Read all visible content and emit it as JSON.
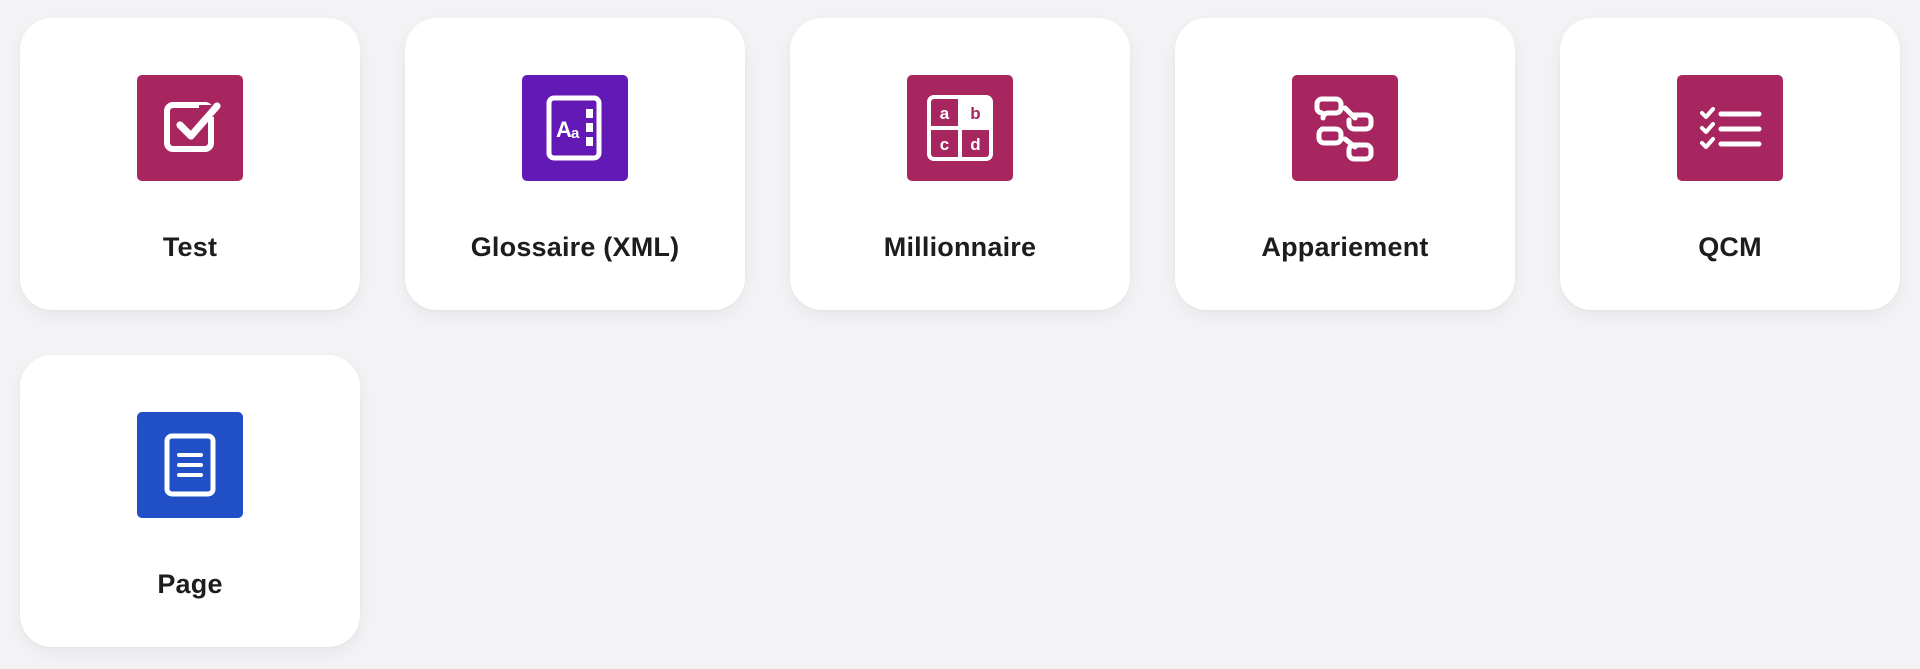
{
  "tiles": [
    {
      "label": "Test",
      "icon": "checkbox-icon",
      "color": "#a8265f"
    },
    {
      "label": "Glossaire (XML)",
      "icon": "glossary-book-icon",
      "color": "#6219b5"
    },
    {
      "label": "Millionnaire",
      "icon": "abcd-grid-icon",
      "color": "#a8265f"
    },
    {
      "label": "Appariement",
      "icon": "matching-connectors-icon",
      "color": "#a8265f"
    },
    {
      "label": "QCM",
      "icon": "checklist-icon",
      "color": "#a8265f"
    },
    {
      "label": "Page",
      "icon": "page-document-icon",
      "color": "#214fc6"
    }
  ],
  "icon_text": {
    "glossary": {
      "big": "A",
      "small": "a"
    },
    "abcd": {
      "a": "a",
      "b": "b",
      "c": "c",
      "d": "d"
    }
  }
}
